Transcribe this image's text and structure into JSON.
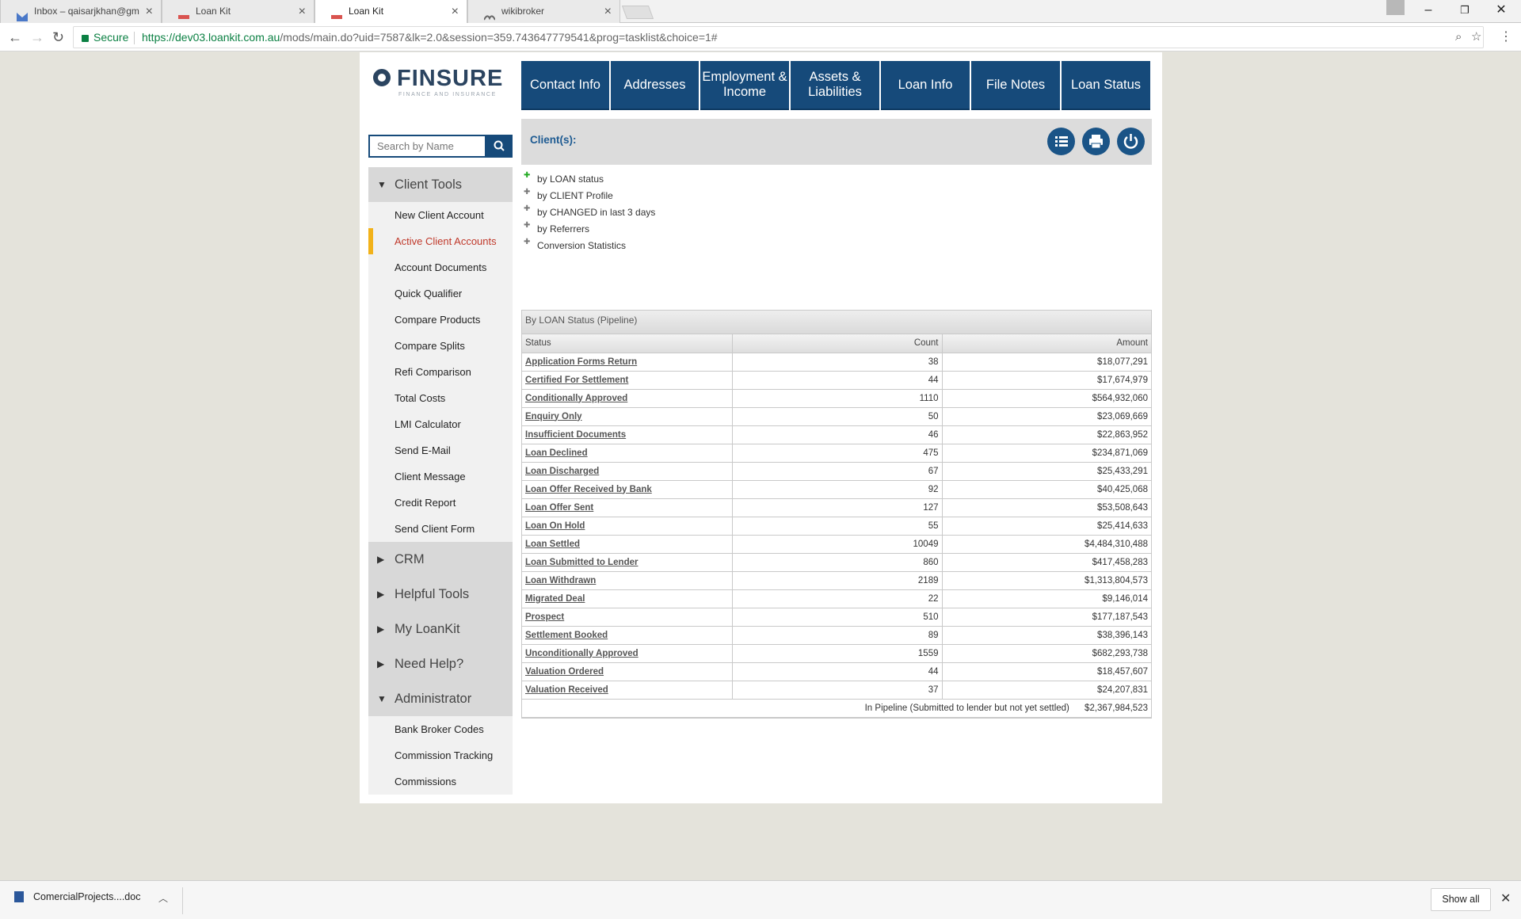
{
  "browser": {
    "tabs": [
      {
        "title": "Inbox – qaisarjkhan@gm",
        "icon": "gmail-icon"
      },
      {
        "title": "Loan Kit",
        "icon": "loankit-icon"
      },
      {
        "title": "Loan Kit",
        "icon": "loankit-icon"
      },
      {
        "title": "wikibroker",
        "icon": "wikibroker-icon"
      }
    ],
    "secure_label": "Secure",
    "url_host": "https://dev03.loankit.com.au",
    "url_path": "/mods/main.do?uid=7587&lk=2.0&session=359.743647779541&prog=tasklist&choice=1#"
  },
  "logo": {
    "brand": "FINSURE",
    "tagline": "FINANCE AND INSURANCE"
  },
  "nav": {
    "contact": "Contact Info",
    "addresses": "Addresses",
    "employment": "Employment & Income",
    "assets": "Assets & Liabilities",
    "loan_info": "Loan Info",
    "file_notes": "File Notes",
    "loan_status": "Loan Status"
  },
  "search": {
    "placeholder": "Search by Name"
  },
  "sidebar": {
    "client_tools": {
      "title": "Client Tools",
      "items": [
        "New Client Account",
        "Active Client Accounts",
        "Account Documents",
        "Quick Qualifier",
        "Compare Products",
        "Compare Splits",
        "Refi Comparison",
        "Total Costs",
        "LMI Calculator",
        "Send E-Mail",
        "Client Message",
        "Credit Report",
        "Send Client Form"
      ]
    },
    "crm": "CRM",
    "helpful_tools": "Helpful Tools",
    "my_loankit": "My LoanKit",
    "need_help": "Need Help?",
    "administrator": {
      "title": "Administrator",
      "items": [
        "Bank Broker Codes",
        "Commission Tracking",
        "Commissions"
      ]
    }
  },
  "clients": {
    "title": "Client(s):",
    "filters": [
      "by LOAN status",
      "by CLIENT Profile",
      "by CHANGED in last 3 days",
      "by Referrers",
      "Conversion Statistics"
    ]
  },
  "pipeline": {
    "heading": "By LOAN Status (Pipeline)",
    "columns": {
      "status": "Status",
      "count": "Count",
      "amount": "Amount"
    },
    "rows": [
      {
        "status": "Application Forms Return",
        "count": "38",
        "amount": "$18,077,291"
      },
      {
        "status": "Certified For Settlement",
        "count": "44",
        "amount": "$17,674,979"
      },
      {
        "status": "Conditionally Approved",
        "count": "1110",
        "amount": "$564,932,060"
      },
      {
        "status": "Enquiry Only",
        "count": "50",
        "amount": "$23,069,669"
      },
      {
        "status": "Insufficient Documents",
        "count": "46",
        "amount": "$22,863,952"
      },
      {
        "status": "Loan Declined",
        "count": "475",
        "amount": "$234,871,069"
      },
      {
        "status": "Loan Discharged",
        "count": "67",
        "amount": "$25,433,291"
      },
      {
        "status": "Loan Offer Received by Bank",
        "count": "92",
        "amount": "$40,425,068"
      },
      {
        "status": "Loan Offer Sent",
        "count": "127",
        "amount": "$53,508,643"
      },
      {
        "status": "Loan On Hold",
        "count": "55",
        "amount": "$25,414,633"
      },
      {
        "status": "Loan Settled",
        "count": "10049",
        "amount": "$4,484,310,488"
      },
      {
        "status": "Loan Submitted to Lender",
        "count": "860",
        "amount": "$417,458,283"
      },
      {
        "status": "Loan Withdrawn",
        "count": "2189",
        "amount": "$1,313,804,573"
      },
      {
        "status": "Migrated Deal",
        "count": "22",
        "amount": "$9,146,014"
      },
      {
        "status": "Prospect",
        "count": "510",
        "amount": "$177,187,543"
      },
      {
        "status": "Settlement Booked",
        "count": "89",
        "amount": "$38,396,143"
      },
      {
        "status": "Unconditionally Approved",
        "count": "1559",
        "amount": "$682,293,738"
      },
      {
        "status": "Valuation Ordered",
        "count": "44",
        "amount": "$18,457,607"
      },
      {
        "status": "Valuation Received",
        "count": "37",
        "amount": "$24,207,831"
      }
    ],
    "total_label": "In Pipeline (Submitted to lender but not yet settled)",
    "total_amount": "$2,367,984,523"
  },
  "downloads": {
    "file": "ComercialProjects....doc",
    "show_all": "Show all"
  },
  "colors": {
    "nav": "#164a7a",
    "accent": "#f2b21a",
    "active_link": "#c0392b"
  }
}
